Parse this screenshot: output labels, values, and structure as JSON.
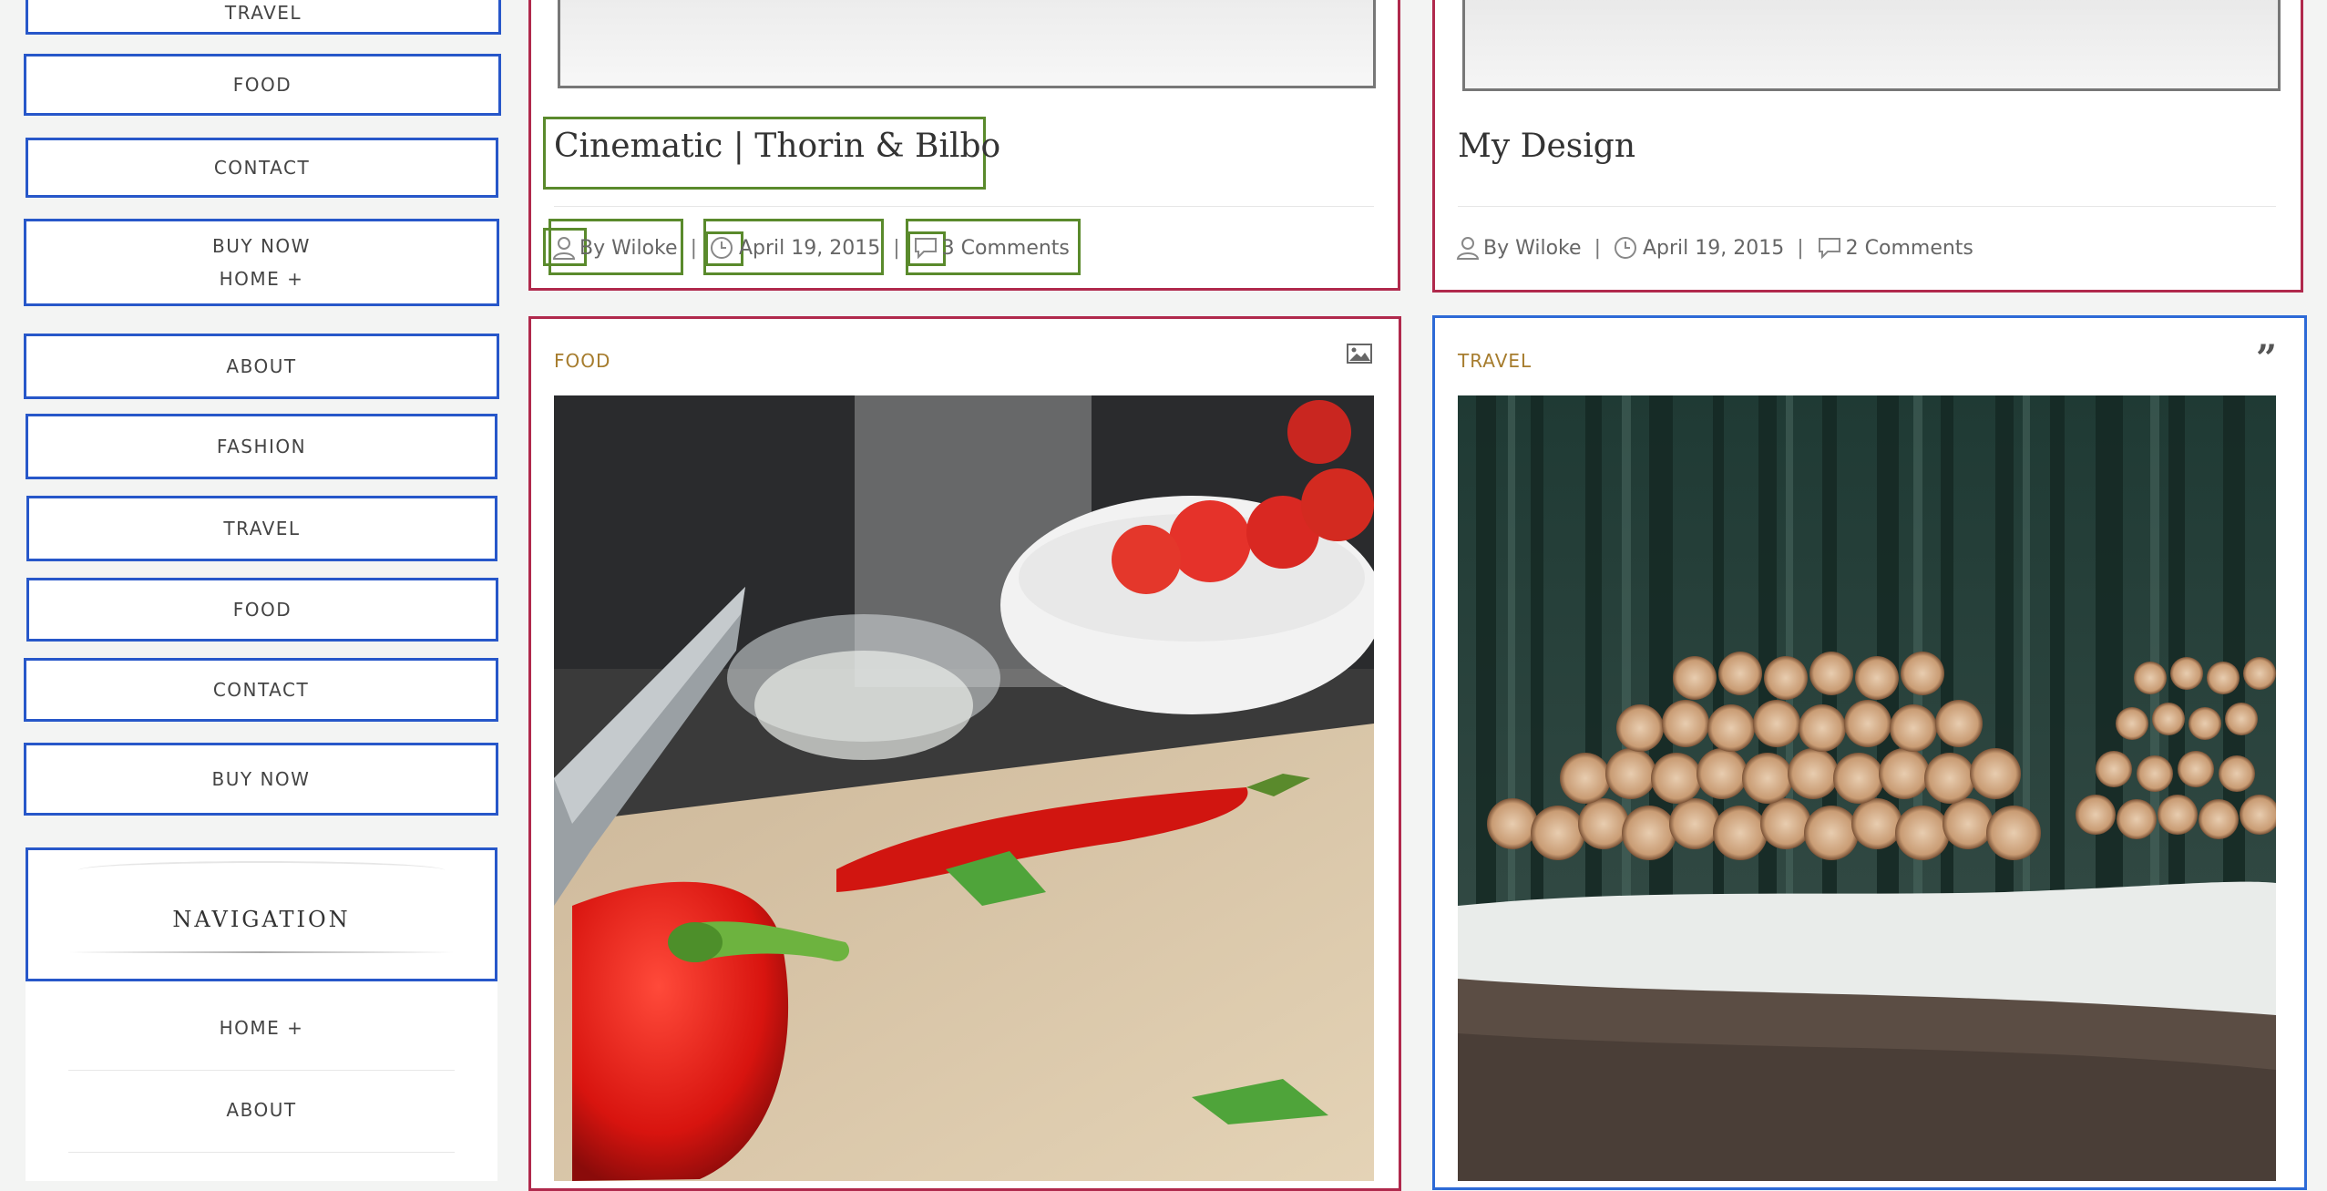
{
  "sidebar": {
    "menu": [
      {
        "label": "TRAVEL"
      },
      {
        "label": "FOOD"
      },
      {
        "label": "CONTACT"
      },
      {
        "label": "BUY NOW",
        "sub": "HOME +"
      },
      {
        "label": "ABOUT"
      },
      {
        "label": "FASHION"
      },
      {
        "label": "TRAVEL"
      },
      {
        "label": "FOOD"
      },
      {
        "label": "CONTACT"
      },
      {
        "label": "BUY NOW"
      }
    ],
    "nav_title": "NAVIGATION",
    "nav_items": [
      "HOME +",
      "ABOUT"
    ]
  },
  "posts": [
    {
      "title": "Cinematic | Thorin & Bilbo",
      "author": "By Wiloke",
      "date": "April 19, 2015",
      "comments": "3 Comments",
      "separator": "|"
    },
    {
      "title": "My Design",
      "author": "By Wiloke",
      "date": "April 19, 2015",
      "comments": "2 Comments",
      "separator": "|"
    },
    {
      "category": "FOOD",
      "format_icon": "image-icon"
    },
    {
      "category": "TRAVEL",
      "format_icon": "quote-icon"
    }
  ],
  "colors": {
    "sidebar_border": "#2757c9",
    "card_border_red": "#b0294c",
    "card_border_blue": "#2d6ad6",
    "category": "#a67c2d",
    "highlight_green": "#5a8a2c"
  }
}
